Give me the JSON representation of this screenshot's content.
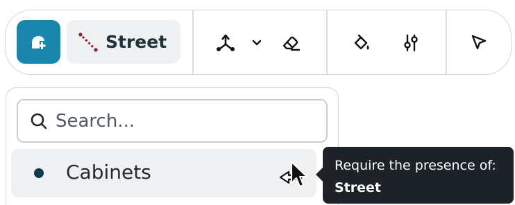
{
  "toolbar": {
    "active_layer_label": "Street",
    "tools": [
      {
        "icon": "add-location-icon"
      },
      {
        "icon": "street-line-icon"
      },
      {
        "icon": "node-tool-icon"
      },
      {
        "icon": "chevron-down-icon"
      },
      {
        "icon": "eraser-icon"
      },
      {
        "icon": "paint-bucket-icon"
      },
      {
        "icon": "sliders-icon"
      },
      {
        "icon": "pointer-icon"
      }
    ]
  },
  "panel": {
    "search": {
      "placeholder": "Search...",
      "value": ""
    },
    "items": [
      {
        "label": "Cabinets",
        "dot_color": "#0f3a4f"
      }
    ]
  },
  "tooltip": {
    "line1": "Require the presence of:",
    "line2": "Street"
  },
  "colors": {
    "primary": "#1a86ab",
    "street_line": "#8b1d2c",
    "tooltip_bg": "#1d2228"
  }
}
